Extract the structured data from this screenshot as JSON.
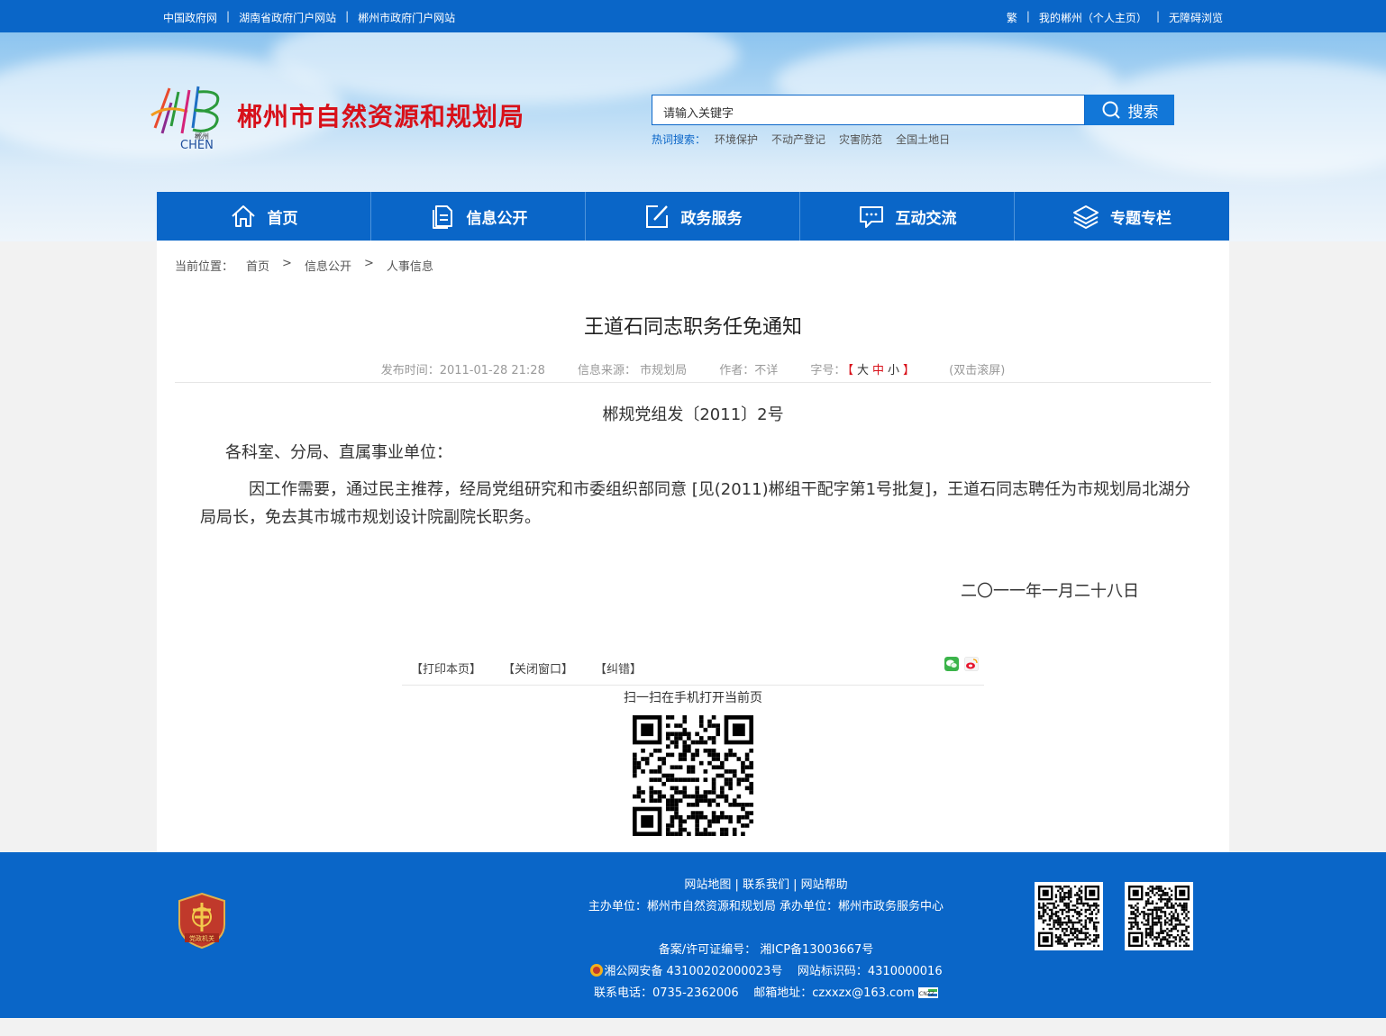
{
  "topbar": {
    "left_links": [
      "中国政府网",
      "湖南省政府门户网站",
      "郴州市政府门户网站"
    ],
    "right_links": [
      "繁",
      "我的郴州（个人主页）",
      "无障碍浏览"
    ]
  },
  "header": {
    "logo_small": "郴州",
    "logo_text": "CHEN",
    "site_title": "郴州市自然资源和规划局",
    "search_value": "请输入关键字",
    "search_button": "搜索",
    "hot_label": "热词搜索：",
    "hot_words": [
      "环境保护",
      "不动产登记",
      "灾害防范",
      "全国土地日"
    ]
  },
  "nav": [
    {
      "label": "首页",
      "icon": "home-icon"
    },
    {
      "label": "信息公开",
      "icon": "document-icon"
    },
    {
      "label": "政务服务",
      "icon": "edit-icon"
    },
    {
      "label": "互动交流",
      "icon": "chat-icon"
    },
    {
      "label": "专题专栏",
      "icon": "layers-icon"
    }
  ],
  "breadcrumb": {
    "label": "当前位置：",
    "items": [
      "首页",
      "信息公开",
      "人事信息"
    ],
    "sep": ">"
  },
  "article": {
    "title": "王道石同志职务任免通知",
    "publish_time": "发布时间：2011-01-28 21:28",
    "source": "信息来源： 市规划局",
    "author": "作者：不详",
    "font_size_label": "字号：",
    "font_sizes": [
      "大",
      "中",
      "小"
    ],
    "dblclick": "(双击滚屏)",
    "doc_no": "郴规党组发〔2011〕2号",
    "salutation": "各科室、分局、直属事业单位：",
    "body": "因工作需要，通过民主推荐，经局党组研究和市委组织部同意 [见(2011)郴组干配字第1号批复]，王道石同志聘任为市规划局北湖分局局长，免去其市城市规划设计院副院长职务。",
    "signature_date": "二〇一一年一月二十八日"
  },
  "tools": {
    "print": "【打印本页】",
    "close": "【关闭窗口】",
    "error": "【纠错】",
    "share_icons": [
      "wechat-icon",
      "weibo-icon"
    ],
    "scan_text": "扫一扫在手机打开当前页"
  },
  "footer": {
    "links": [
      "网站地图",
      "联系我们",
      "网站帮助"
    ],
    "host": "主办单位：郴州市自然资源和规划局    承办单位：郴州市政务服务中心",
    "icp": "备案/许可证编号： 湘ICP备13003667号",
    "police": "湘公网安备 43100202000023号",
    "site_code": "网站标识码：4310000016",
    "phone": "联系电话：0735-2362006",
    "email": "邮箱地址：czxxzx@163.com",
    "badge_text": "党政机关",
    "cnzz": "CNZZ"
  },
  "colors": {
    "primary": "#0a66c8",
    "title_red": "#d8111a"
  }
}
